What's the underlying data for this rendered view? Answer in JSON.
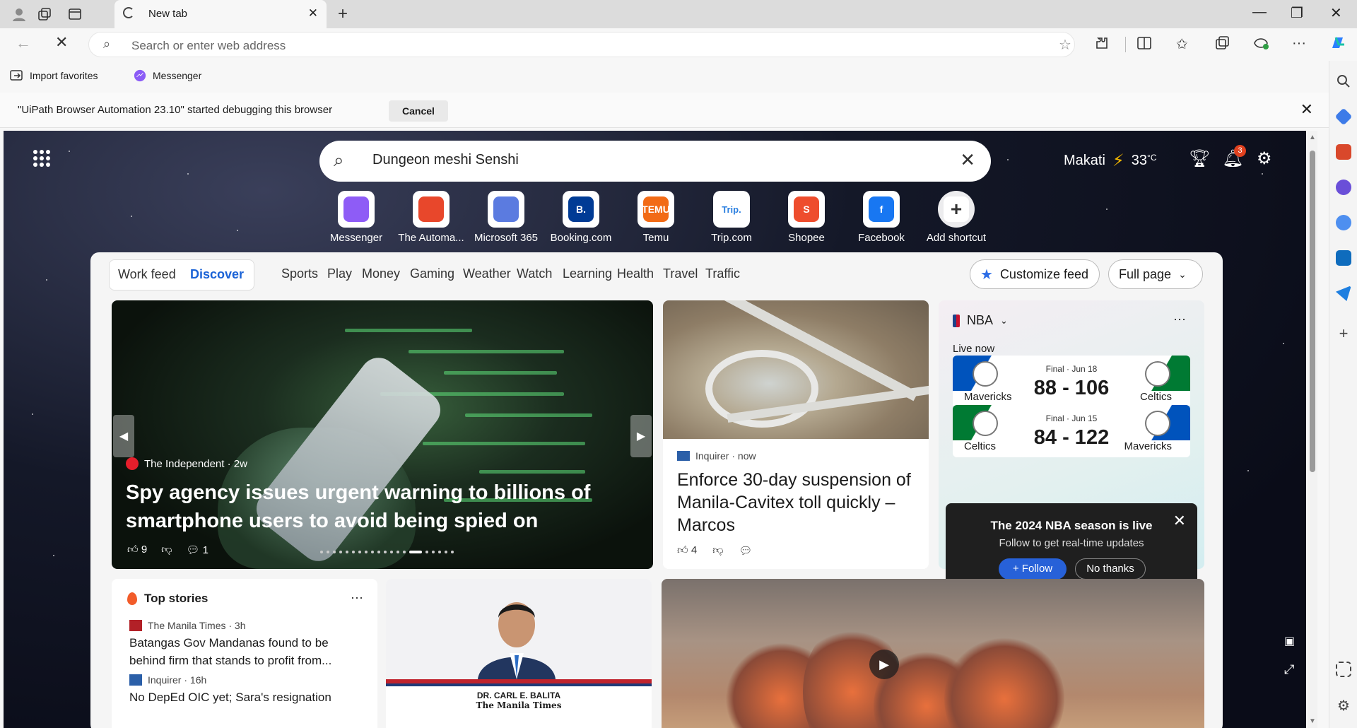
{
  "browser": {
    "tab_title": "New tab",
    "address_placeholder": "Search or enter web address",
    "favorites": [
      "Import favorites",
      "Messenger"
    ],
    "infobar_message": "\"UiPath Browser Automation 23.10\" started debugging this browser",
    "infobar_cancel": "Cancel"
  },
  "page": {
    "search_value": "Dungeon meshi Senshi",
    "location": "Makati",
    "temperature": "33",
    "temp_unit": "°C",
    "notification_count": "3",
    "shortcuts": [
      {
        "label": "Messenger",
        "color": "#8e5cf6"
      },
      {
        "label": "The Automa...",
        "color": "#e8472b"
      },
      {
        "label": "Microsoft 365",
        "color": "#5b7be0"
      },
      {
        "label": "Booking.com",
        "color": "#003b95",
        "text": "B."
      },
      {
        "label": "Temu",
        "color": "#f26b16",
        "text": "TEMU"
      },
      {
        "label": "Trip.com",
        "color": "#ffffff",
        "text": "Trip."
      },
      {
        "label": "Shopee",
        "color": "#ee4d2d",
        "text": "S"
      },
      {
        "label": "Facebook",
        "color": "#1877f2",
        "text": "f"
      },
      {
        "label": "Add shortcut",
        "color": "#ffffff",
        "text": "+"
      }
    ]
  },
  "feed": {
    "seg_work": "Work feed",
    "seg_discover": "Discover",
    "nav": [
      "Sports",
      "Play",
      "Money",
      "Gaming",
      "Weather",
      "Watch",
      "Learning",
      "Health",
      "Travel",
      "Traffic"
    ],
    "customize": "Customize feed",
    "layout": "Full page",
    "hero": {
      "source": "The Independent · 2w",
      "headline": "Spy agency issues urgent warning to billions of smartphone users to avoid being spied on",
      "likes": "9",
      "comments": "1"
    },
    "story2": {
      "source": "Inquirer · now",
      "headline": "Enforce 30-day suspension of Manila-Cavitex toll quickly – Marcos",
      "likes": "4"
    },
    "nba": {
      "title": "NBA",
      "live": "Live now",
      "games": [
        {
          "status": "Final · Jun 18",
          "score": "88 - 106",
          "left": "Mavericks",
          "right": "Celtics"
        },
        {
          "status": "Final · Jun 15",
          "score": "84 - 122",
          "left": "Celtics",
          "right": "Mavericks"
        }
      ],
      "popup_title": "The 2024 NBA season is live",
      "popup_sub": "Follow to get real-time updates",
      "follow": "Follow",
      "no_thanks": "No thanks"
    },
    "top_stories": {
      "title": "Top stories",
      "items": [
        {
          "source": "The Manila Times · 3h",
          "headline": "Batangas Gov Mandanas found to be behind firm that stands to profit from..."
        },
        {
          "source": "Inquirer · 16h",
          "headline": "No DepEd OIC yet; Sara's resignation"
        }
      ]
    },
    "balita": {
      "caption": "DR. CARL E. BALITA",
      "paper": "The Manila Times"
    }
  }
}
